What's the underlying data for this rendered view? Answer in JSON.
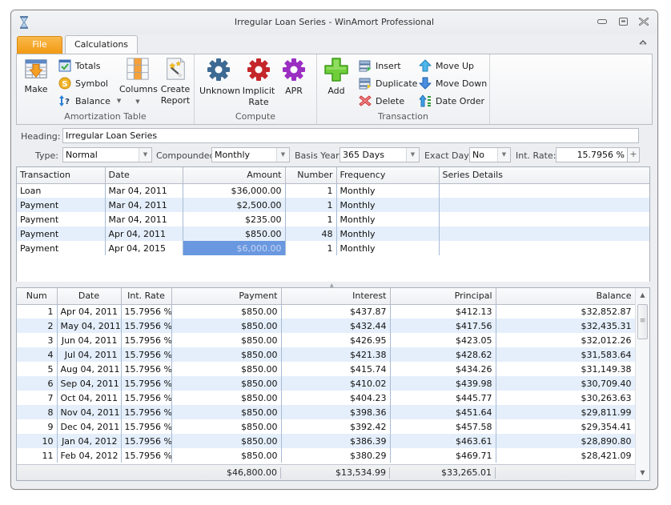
{
  "window": {
    "title": "Irregular Loan Series - WinAmort Professional",
    "controls": {
      "minimize": "minimize",
      "maximize": "maximize",
      "close": "close"
    }
  },
  "tabs": [
    {
      "label": "File",
      "active": false
    },
    {
      "label": "Calculations",
      "active": true
    }
  ],
  "ribbon": {
    "groups": {
      "amortization_table": {
        "label": "Amortization Table",
        "make": "Make",
        "totals": "Totals",
        "symbol": "Symbol",
        "balance": "Balance",
        "columns": "Columns",
        "create_report_line1": "Create",
        "create_report_line2": "Report"
      },
      "compute": {
        "label": "Compute",
        "unknown": "Unknown",
        "implicit_rate_line1": "Implicit",
        "implicit_rate_line2": "Rate",
        "apr": "APR"
      },
      "transaction": {
        "label": "Transaction",
        "add": "Add",
        "insert": "Insert",
        "duplicate": "Duplicate",
        "delete": "Delete",
        "move_up": "Move Up",
        "move_down": "Move Down",
        "date_order": "Date Order"
      }
    }
  },
  "form": {
    "heading_label": "Heading:",
    "heading_value": "Irregular Loan Series",
    "type_label": "Type:",
    "type_value": "Normal",
    "compounded_label": "Compounded:",
    "compounded_value": "Monthly",
    "basis_year_label": "Basis Year:",
    "basis_year_value": "365 Days",
    "exact_day_label": "Exact Day:",
    "exact_day_value": "No",
    "int_rate_label": "Int. Rate:",
    "int_rate_value": "15.7956 %",
    "int_rate_button": "+"
  },
  "transactions": {
    "columns": [
      "Transaction",
      "Date",
      "Amount",
      "Number",
      "Frequency",
      "Series Details"
    ],
    "rows": [
      {
        "transaction": "Loan",
        "date": "Mar 04, 2011",
        "amount": "$36,000.00",
        "number": "1",
        "frequency": "Monthly",
        "details": ""
      },
      {
        "transaction": "Payment",
        "date": "Mar 04, 2011",
        "amount": "$2,500.00",
        "number": "1",
        "frequency": "Monthly",
        "details": ""
      },
      {
        "transaction": "Payment",
        "date": "Mar 04, 2011",
        "amount": "$235.00",
        "number": "1",
        "frequency": "Monthly",
        "details": ""
      },
      {
        "transaction": "Payment",
        "date": "Apr 04, 2011",
        "amount": "$850.00",
        "number": "48",
        "frequency": "Monthly",
        "details": ""
      },
      {
        "transaction": "Payment",
        "date": "Apr 04, 2015",
        "amount": "$6,000.00",
        "number": "1",
        "frequency": "Monthly",
        "details": ""
      }
    ],
    "selected_cell": {
      "row": 4,
      "column": "Amount"
    }
  },
  "schedule": {
    "columns": [
      "Num",
      "Date",
      "Int. Rate",
      "Payment",
      "Interest",
      "Principal",
      "Balance"
    ],
    "rows": [
      {
        "num": "1",
        "date": "Apr 04, 2011",
        "rate": "15.7956 %",
        "payment": "$850.00",
        "interest": "$437.87",
        "principal": "$412.13",
        "balance": "$32,852.87"
      },
      {
        "num": "2",
        "date": "May 04, 2011",
        "rate": "15.7956 %",
        "payment": "$850.00",
        "interest": "$432.44",
        "principal": "$417.56",
        "balance": "$32,435.31"
      },
      {
        "num": "3",
        "date": "Jun 04, 2011",
        "rate": "15.7956 %",
        "payment": "$850.00",
        "interest": "$426.95",
        "principal": "$423.05",
        "balance": "$32,012.26"
      },
      {
        "num": "4",
        "date": "Jul 04, 2011",
        "rate": "15.7956 %",
        "payment": "$850.00",
        "interest": "$421.38",
        "principal": "$428.62",
        "balance": "$31,583.64"
      },
      {
        "num": "5",
        "date": "Aug 04, 2011",
        "rate": "15.7956 %",
        "payment": "$850.00",
        "interest": "$415.74",
        "principal": "$434.26",
        "balance": "$31,149.38"
      },
      {
        "num": "6",
        "date": "Sep 04, 2011",
        "rate": "15.7956 %",
        "payment": "$850.00",
        "interest": "$410.02",
        "principal": "$439.98",
        "balance": "$30,709.40"
      },
      {
        "num": "7",
        "date": "Oct 04, 2011",
        "rate": "15.7956 %",
        "payment": "$850.00",
        "interest": "$404.23",
        "principal": "$445.77",
        "balance": "$30,263.63"
      },
      {
        "num": "8",
        "date": "Nov 04, 2011",
        "rate": "15.7956 %",
        "payment": "$850.00",
        "interest": "$398.36",
        "principal": "$451.64",
        "balance": "$29,811.99"
      },
      {
        "num": "9",
        "date": "Dec 04, 2011",
        "rate": "15.7956 %",
        "payment": "$850.00",
        "interest": "$392.42",
        "principal": "$457.58",
        "balance": "$29,354.41"
      },
      {
        "num": "10",
        "date": "Jan 04, 2012",
        "rate": "15.7956 %",
        "payment": "$850.00",
        "interest": "$386.39",
        "principal": "$463.61",
        "balance": "$28,890.80"
      },
      {
        "num": "11",
        "date": "Feb 04, 2012",
        "rate": "15.7956 %",
        "payment": "$850.00",
        "interest": "$380.29",
        "principal": "$469.71",
        "balance": "$28,421.09"
      }
    ],
    "totals": {
      "payment": "$46,800.00",
      "interest": "$13,534.99",
      "principal": "$33,265.01"
    }
  },
  "colors": {
    "file_tab": "#f29a13",
    "selected_cell": "#6a98e0",
    "alt_row": "#e5effb"
  }
}
